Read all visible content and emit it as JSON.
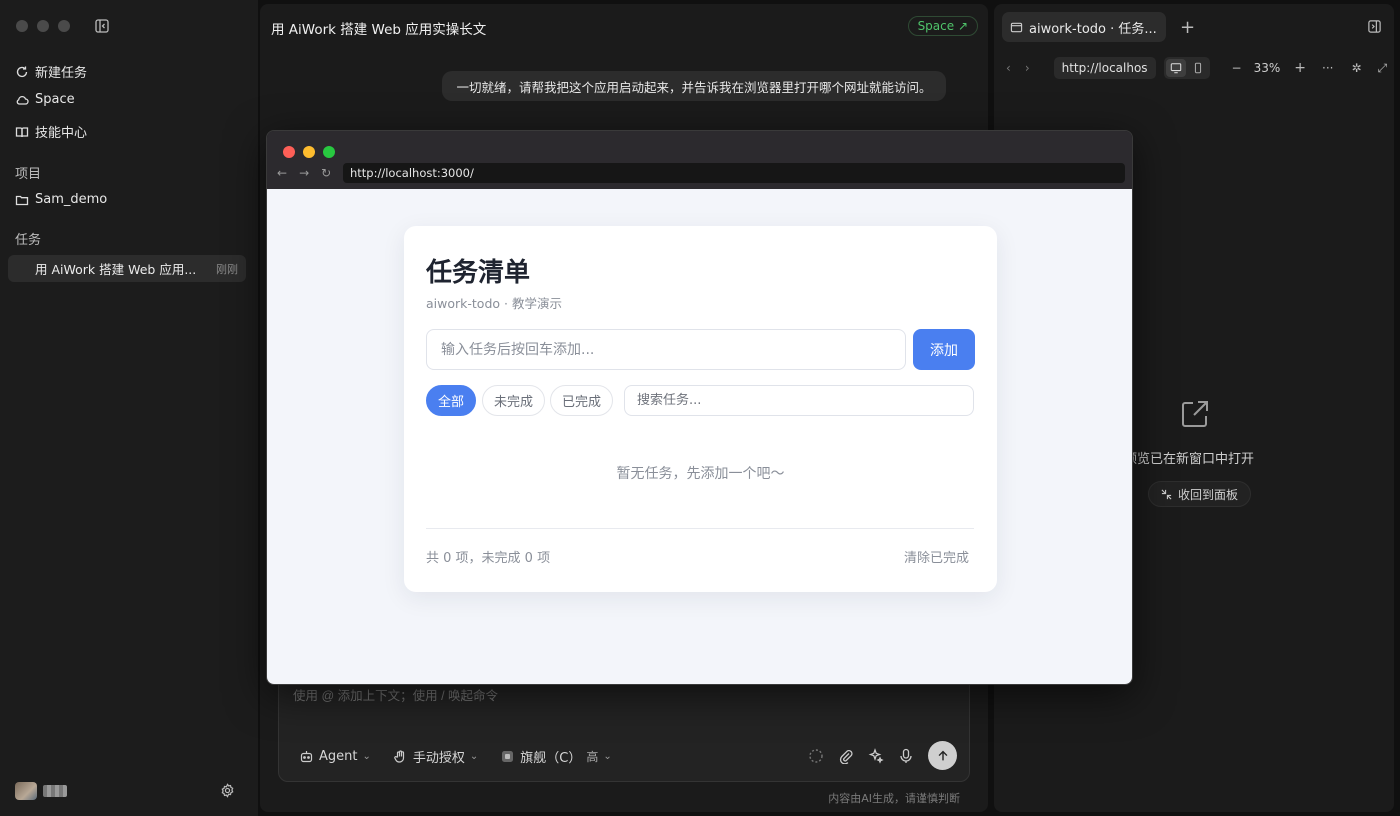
{
  "sidebar": {
    "nav": [
      {
        "label": "新建任务",
        "icon": "refresh-plus-icon"
      },
      {
        "label": "Space",
        "icon": "cloud-icon"
      },
      {
        "label": "技能中心",
        "icon": "book-icon"
      }
    ],
    "projects_label": "项目",
    "project": {
      "label": "Sam_demo",
      "icon": "folder-icon"
    },
    "tasks_label": "任务",
    "task": {
      "title": "用 AiWork 搭建 Web 应用...",
      "time": "刚刚"
    }
  },
  "chat": {
    "title": "用 AiWork 搭建 Web 应用实操长文",
    "space_badge": "Space ↗",
    "user_message": "一切就绪，请帮我把这个应用启动起来，并告诉我在浏览器里打开哪个网址就能访问。",
    "composer_placeholder": "使用 @ 添加上下文；使用 / 唤起命令",
    "tools": {
      "agent": "Agent",
      "auth": "手动授权",
      "model": "旗舰（C）",
      "level": "高"
    },
    "disclaimer": "内容由AI生成，请谨慎判断"
  },
  "preview": {
    "tab_title": "aiwork-todo · 任务...",
    "url": "http://localhos",
    "zoom": "33%",
    "opened_message": "预览已在新窗口中打开",
    "back_button": "收回到面板"
  },
  "browser": {
    "url": "http://localhost:3000/",
    "traffic_colors": [
      "#fe5f57",
      "#febc2e",
      "#28c840"
    ]
  },
  "todo": {
    "title": "任务清单",
    "subtitle": "aiwork-todo · 教学演示",
    "input_placeholder": "输入任务后按回车添加...",
    "add_label": "添加",
    "filters": [
      "全部",
      "未完成",
      "已完成"
    ],
    "search_placeholder": "搜索任务...",
    "empty_message": "暂无任务，先添加一个吧～",
    "stats": "共 0 项，未完成 0 项",
    "clear_label": "清除已完成"
  },
  "colors": {
    "accent": "#4a7ff0",
    "space_green": "#4fc36a"
  }
}
